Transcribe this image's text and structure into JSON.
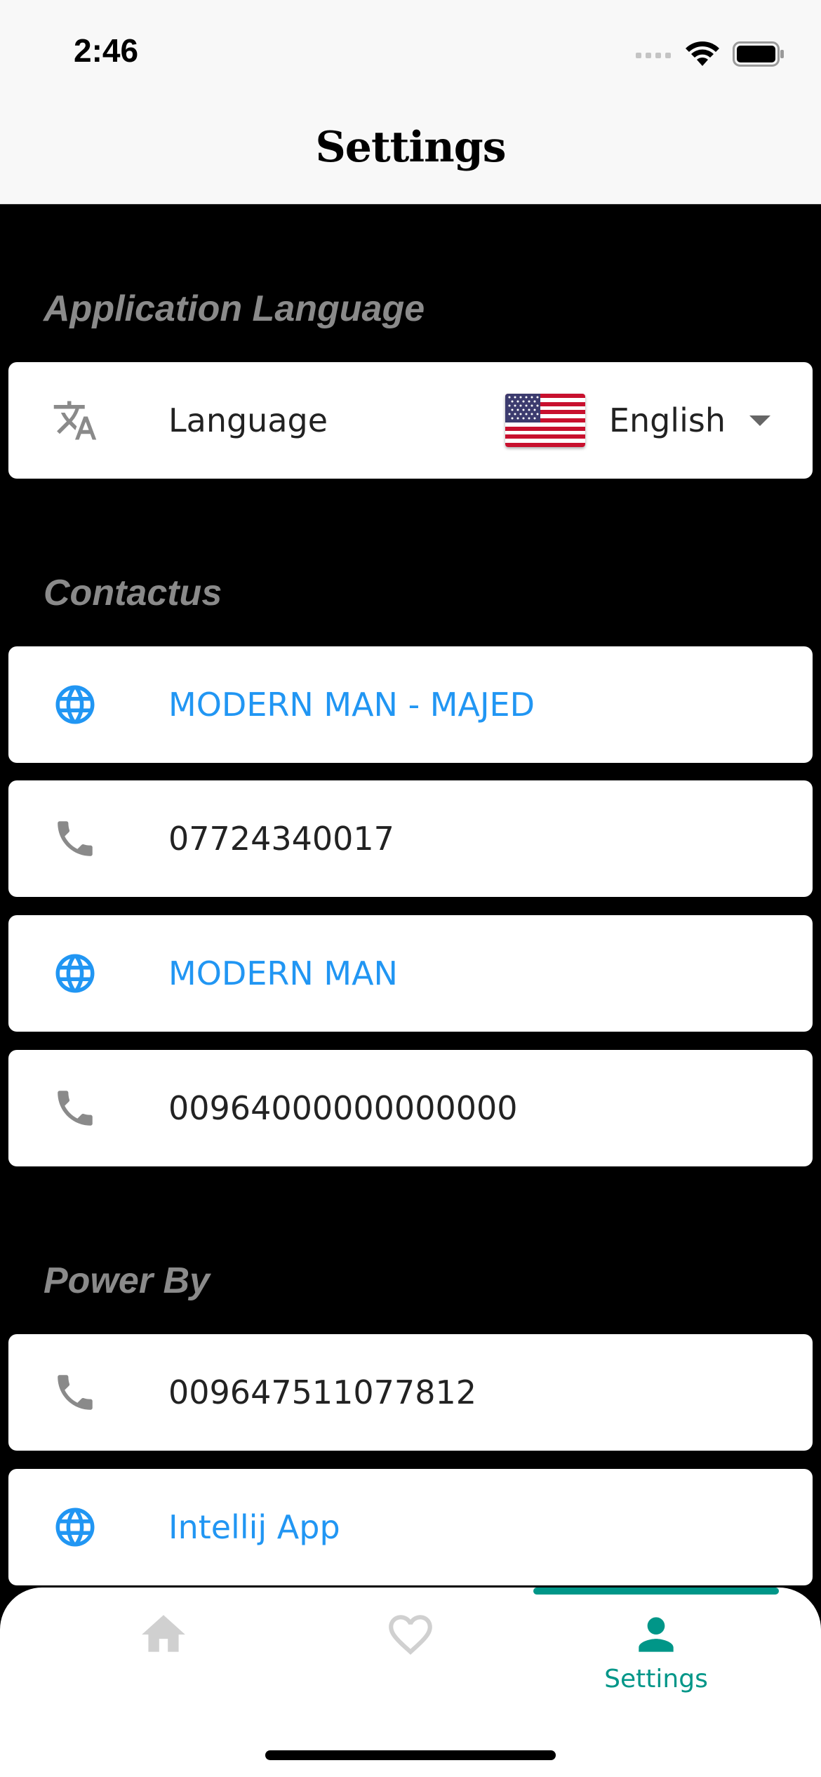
{
  "status_bar": {
    "time": "2:46"
  },
  "header": {
    "title": "Settings"
  },
  "sections": {
    "language": {
      "title": "Application Language",
      "label": "Language",
      "value": "English",
      "icon": "translate-icon"
    },
    "contact": {
      "title": "Contactus",
      "items": [
        {
          "icon": "globe-icon",
          "text": "MODERN MAN - MAJED"
        },
        {
          "icon": "phone-icon",
          "text": "07724340017"
        },
        {
          "icon": "globe-icon",
          "text": "MODERN MAN"
        },
        {
          "icon": "phone-icon",
          "text": "00964000000000000"
        }
      ]
    },
    "power": {
      "title": "Power By",
      "items": [
        {
          "icon": "phone-icon",
          "text": "009647511077812"
        },
        {
          "icon": "globe-icon",
          "text": "Intellij App"
        }
      ]
    }
  },
  "tabs": [
    {
      "icon": "home-icon",
      "label": ""
    },
    {
      "icon": "heart-icon",
      "label": ""
    },
    {
      "icon": "person-icon",
      "label": "Settings"
    }
  ],
  "colors": {
    "accent": "#009688",
    "link": "#2196f3",
    "section_title": "#8a8a8a"
  }
}
